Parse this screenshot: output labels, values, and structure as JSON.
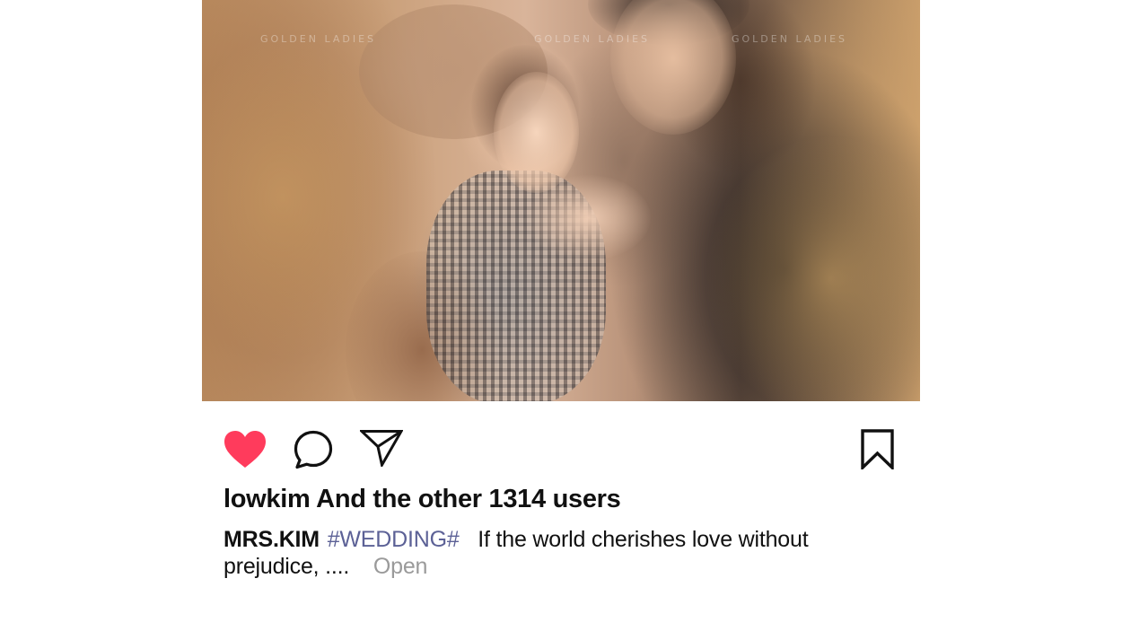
{
  "post": {
    "photo_watermark_text": "GOLDEN LADIES",
    "actions": {
      "like_icon": "heart-filled-icon",
      "comment_icon": "speech-bubble-icon",
      "share_icon": "paper-plane-icon",
      "save_icon": "bookmark-icon",
      "liked": true,
      "like_color": "#ff3b5c"
    },
    "likes_text": "lowkim And the other 1314 users",
    "caption": {
      "author": "MRS.KIM",
      "hashtag": "#WEDDING#",
      "text": "If the world cherishes love without prejudice, ....",
      "open_label": "Open",
      "hashtag_color": "#5c6196",
      "open_color": "#9a9a9a"
    }
  }
}
